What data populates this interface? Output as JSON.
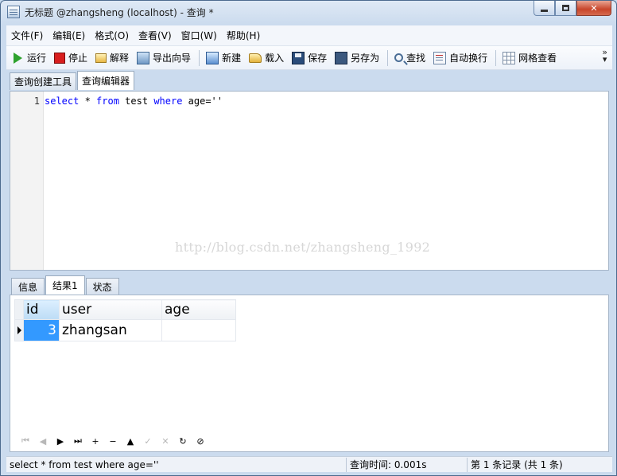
{
  "window": {
    "title": "无标题 @zhangsheng (localhost) - 查询 *",
    "controls": {
      "minimize": "",
      "maximize": "",
      "close": "✕"
    }
  },
  "menubar": {
    "items": [
      "文件(F)",
      "编辑(E)",
      "格式(O)",
      "查看(V)",
      "窗口(W)",
      "帮助(H)"
    ]
  },
  "toolbar": {
    "run": "运行",
    "stop": "停止",
    "explain": "解释",
    "export_wizard": "导出向导",
    "new": "新建",
    "load": "载入",
    "save": "保存",
    "save_as": "另存为",
    "find": "查找",
    "word_wrap": "自动换行",
    "grid_view": "网格查看",
    "more": "»"
  },
  "editor_tabs": [
    "查询创建工具",
    "查询编辑器"
  ],
  "editor": {
    "line_number": "1",
    "sql": {
      "kw1": "select",
      "t1": " * ",
      "kw2": "from",
      "t2": " test ",
      "kw3": "where",
      "t3": " age=''"
    },
    "watermark": "http://blog.csdn.net/zhangsheng_1992"
  },
  "result_tabs": [
    "信息",
    "结果1",
    "状态"
  ],
  "results": {
    "columns": [
      "id",
      "user",
      "age"
    ],
    "rows": [
      {
        "id": "3",
        "user": "zhangsan",
        "age": ""
      }
    ]
  },
  "navigation": {
    "first": "⏮",
    "prev": "◀",
    "next": "▶",
    "last": "⏭",
    "add": "+",
    "delete": "−",
    "up": "▲",
    "apply": "✓",
    "discard": "✕",
    "refresh": "↻",
    "cancel": "⊘"
  },
  "statusbar": {
    "query": "select * from test where age=''",
    "time": "查询时间: 0.001s",
    "records": "第 1 条记录 (共 1 条)"
  },
  "colors": {
    "keyword": "#0000ff",
    "selected_cell": "#3399ff",
    "run_icon": "#2ea22e",
    "stop_icon": "#d81e1e"
  }
}
